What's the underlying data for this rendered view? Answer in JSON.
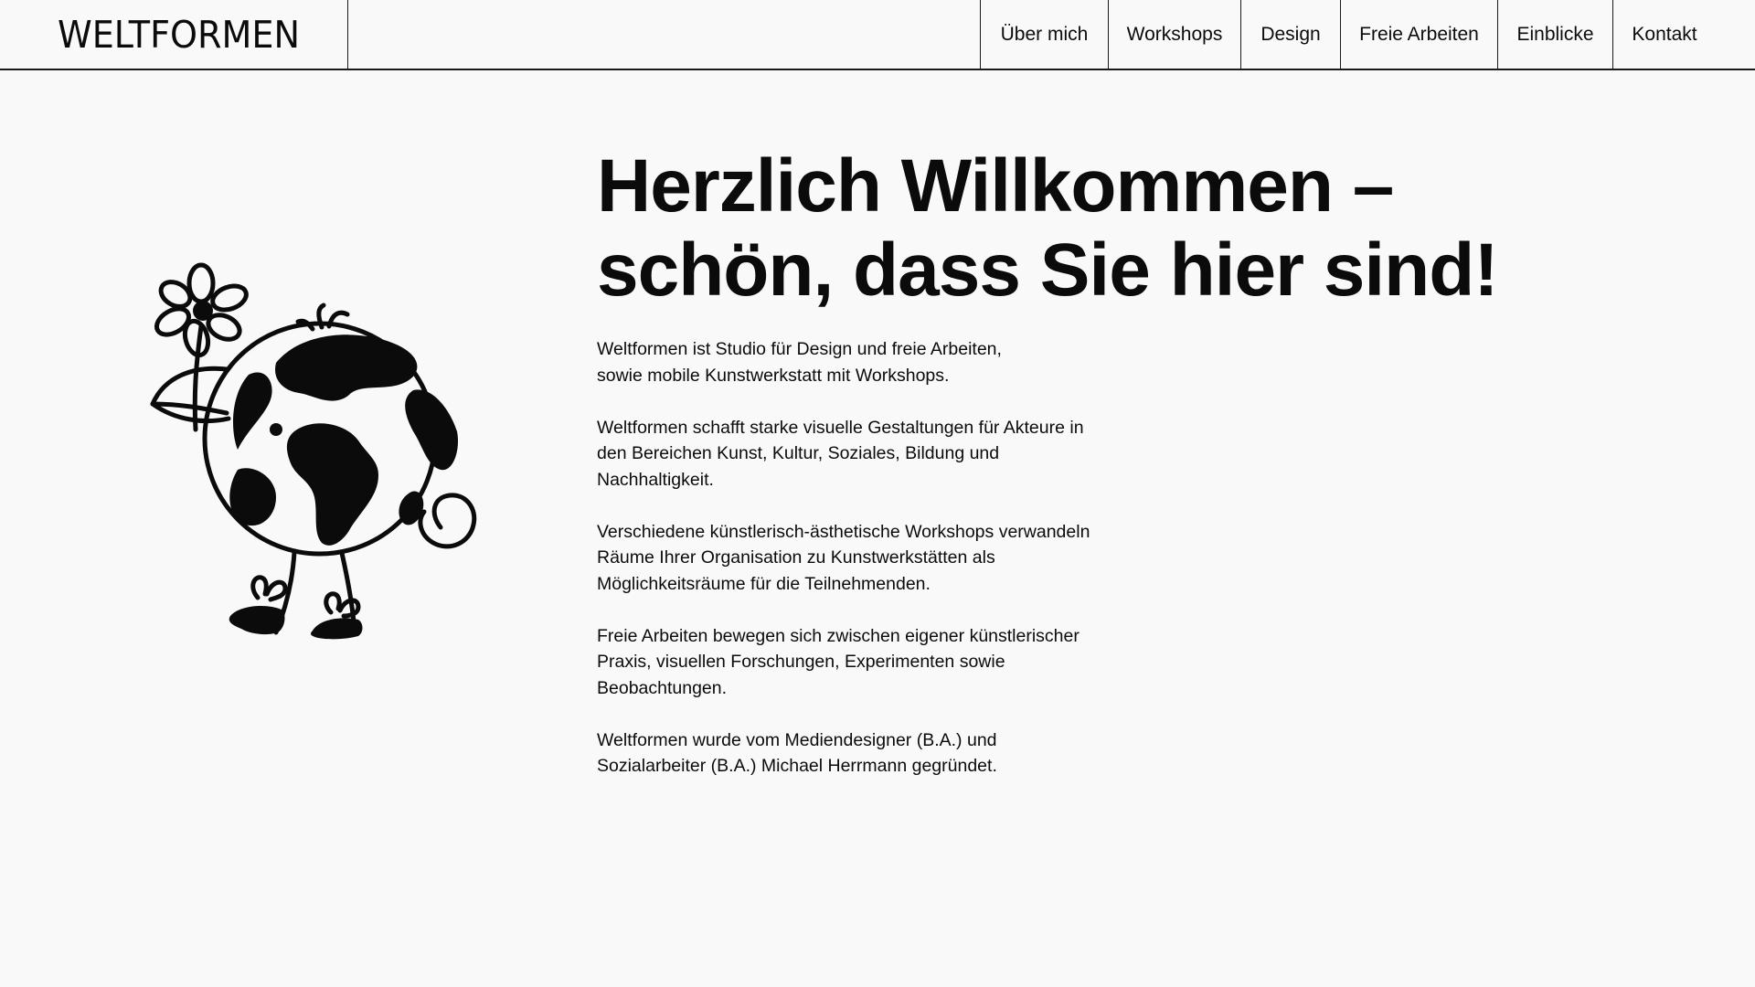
{
  "brand": {
    "logo_text": "WELTFORMEN"
  },
  "nav": {
    "items": [
      {
        "label": "Über mich"
      },
      {
        "label": "Workshops"
      },
      {
        "label": "Design"
      },
      {
        "label": "Freie Arbeiten"
      },
      {
        "label": "Einblicke"
      },
      {
        "label": "Kontakt"
      }
    ]
  },
  "hero": {
    "illustration": "globe-character-with-flower-illustration",
    "heading_line1": "Herzlich Willkommen –",
    "heading_line2": "schön, dass Sie hier sind!"
  },
  "content": {
    "paragraphs": [
      "Weltformen ist Studio für Design und freie Arbeiten,\nsowie mobile Kunstwerkstatt mit Workshops.",
      "Weltformen schafft starke visuelle Gestaltungen für Akteure in\nden Bereichen Kunst, Kultur, Soziales, Bildung und\nNachhaltigkeit.",
      "Verschiedene künstlerisch-ästhetische Workshops verwandeln\nRäume Ihrer Organisation zu Kunstwerkstätten als\nMöglichkeitsräume für die Teilnehmenden.",
      "Freie Arbeiten bewegen sich zwischen eigener künstlerischer\nPraxis, visuellen Forschungen, Experimenten sowie\nBeobachtungen.",
      "Weltformen wurde vom Mediendesigner (B.A.) und\nSozialarbeiter (B.A.) Michael Herrmann gegründet."
    ]
  },
  "colors": {
    "background": "#f9f9f9",
    "text": "#0b0b0b",
    "border": "#1a1a1a"
  }
}
